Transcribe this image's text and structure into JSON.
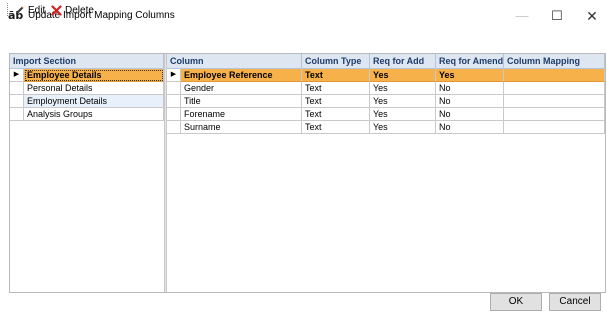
{
  "window": {
    "title": "Update Import Mapping Columns",
    "icon_text": "āb",
    "minimize_glyph": "—",
    "maximize_glyph": "☐",
    "close_glyph": "✕"
  },
  "toolbar": {
    "edit_label": "Edit",
    "delete_label": "Delete",
    "edit_icon": "pencil-icon",
    "delete_icon": "red-x-icon",
    "delete_color": "#d21f1f"
  },
  "import_sections": {
    "header": "Import Section",
    "rows": [
      "Employee Details",
      "Personal Details",
      "Employment Details",
      "Analysis Groups"
    ],
    "selected_index": 0
  },
  "columns_grid": {
    "headers": [
      "Column",
      "Column Type",
      "Req for Add",
      "Req for Amend",
      "Column Mapping"
    ],
    "rows": [
      [
        "Employee Reference",
        "Text",
        "Yes",
        "Yes",
        ""
      ],
      [
        "Gender",
        "Text",
        "Yes",
        "No",
        ""
      ],
      [
        "Title",
        "Text",
        "Yes",
        "No",
        ""
      ],
      [
        "Forename",
        "Text",
        "Yes",
        "No",
        ""
      ],
      [
        "Surname",
        "Text",
        "Yes",
        "No",
        ""
      ]
    ],
    "selected_index": 0
  },
  "footer": {
    "ok_label": "OK",
    "cancel_label": "Cancel"
  },
  "colors": {
    "selected_row": "#f7b14a",
    "header_bg": "#dde6f1",
    "alt_row": "#e8f1fb"
  },
  "row_marker": "▶"
}
